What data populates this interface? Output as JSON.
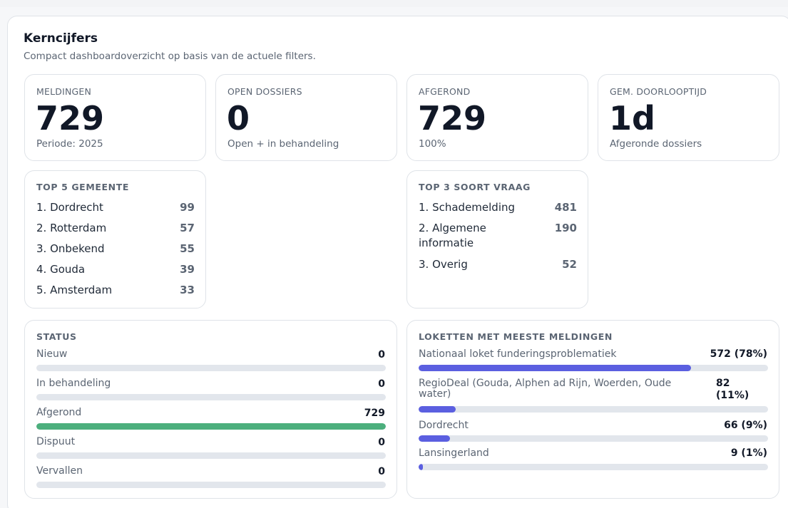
{
  "header": {
    "title": "Kerncijfers",
    "subtitle": "Compact dashboardoverzicht op basis van de actuele filters."
  },
  "kpis": [
    {
      "label": "MELDINGEN",
      "value": "729",
      "sub": "Periode: 2025"
    },
    {
      "label": "OPEN DOSSIERS",
      "value": "0",
      "sub": "Open + in behandeling"
    },
    {
      "label": "AFGEROND",
      "value": "729",
      "sub": "100%"
    },
    {
      "label": "GEM. DOORLOOPTIJD",
      "value": "1d",
      "sub": "Afgeronde dossiers"
    }
  ],
  "top_gemeente": {
    "heading": "TOP 5 GEMEENTE",
    "items": [
      {
        "label": "1. Dordrecht",
        "value": "99"
      },
      {
        "label": "2. Rotterdam",
        "value": "57"
      },
      {
        "label": "3. Onbekend",
        "value": "55"
      },
      {
        "label": "4. Gouda",
        "value": "39"
      },
      {
        "label": "5. Amsterdam",
        "value": "33"
      }
    ]
  },
  "top_soort_vraag": {
    "heading": "TOP 3 SOORT VRAAG",
    "items": [
      {
        "label_line1": "1. Schademelding",
        "label_line2": "",
        "value": "481"
      },
      {
        "label_line1": "2. Algemene",
        "label_line2": "informatie",
        "value": "190"
      },
      {
        "label_line1": "3. Overig",
        "label_line2": "",
        "value": "52"
      }
    ]
  },
  "status": {
    "heading": "STATUS",
    "bar_color": "#4caf7d",
    "items": [
      {
        "label": "Nieuw",
        "value": "0",
        "fraction": 0
      },
      {
        "label": "In behandeling",
        "value": "0",
        "fraction": 0
      },
      {
        "label": "Afgerond",
        "value": "729",
        "fraction": 1
      },
      {
        "label": "Dispuut",
        "value": "0",
        "fraction": 0
      },
      {
        "label": "Vervallen",
        "value": "0",
        "fraction": 0
      }
    ]
  },
  "loketten": {
    "heading": "LOKETTEN MET MEESTE MELDINGEN",
    "bar_color": "#5b5fe0",
    "items": [
      {
        "label_line1": "Nationaal loket funderingsproblematiek",
        "label_line2": "",
        "value_line1": "572 (78%)",
        "value_line2": "",
        "fraction": 0.78
      },
      {
        "label_line1": "RegioDeal (Gouda, Alphen ad Rijn, Woerden, Oude",
        "label_line2": "water)",
        "value_line1": "82",
        "value_line2": "(11%)",
        "fraction": 0.107
      },
      {
        "label_line1": "Dordrecht",
        "label_line2": "",
        "value_line1": "66 (9%)",
        "value_line2": "",
        "fraction": 0.09
      },
      {
        "label_line1": "Lansingerland",
        "label_line2": "",
        "value_line1": "9 (1%)",
        "value_line2": "",
        "fraction": 0.01
      }
    ]
  }
}
